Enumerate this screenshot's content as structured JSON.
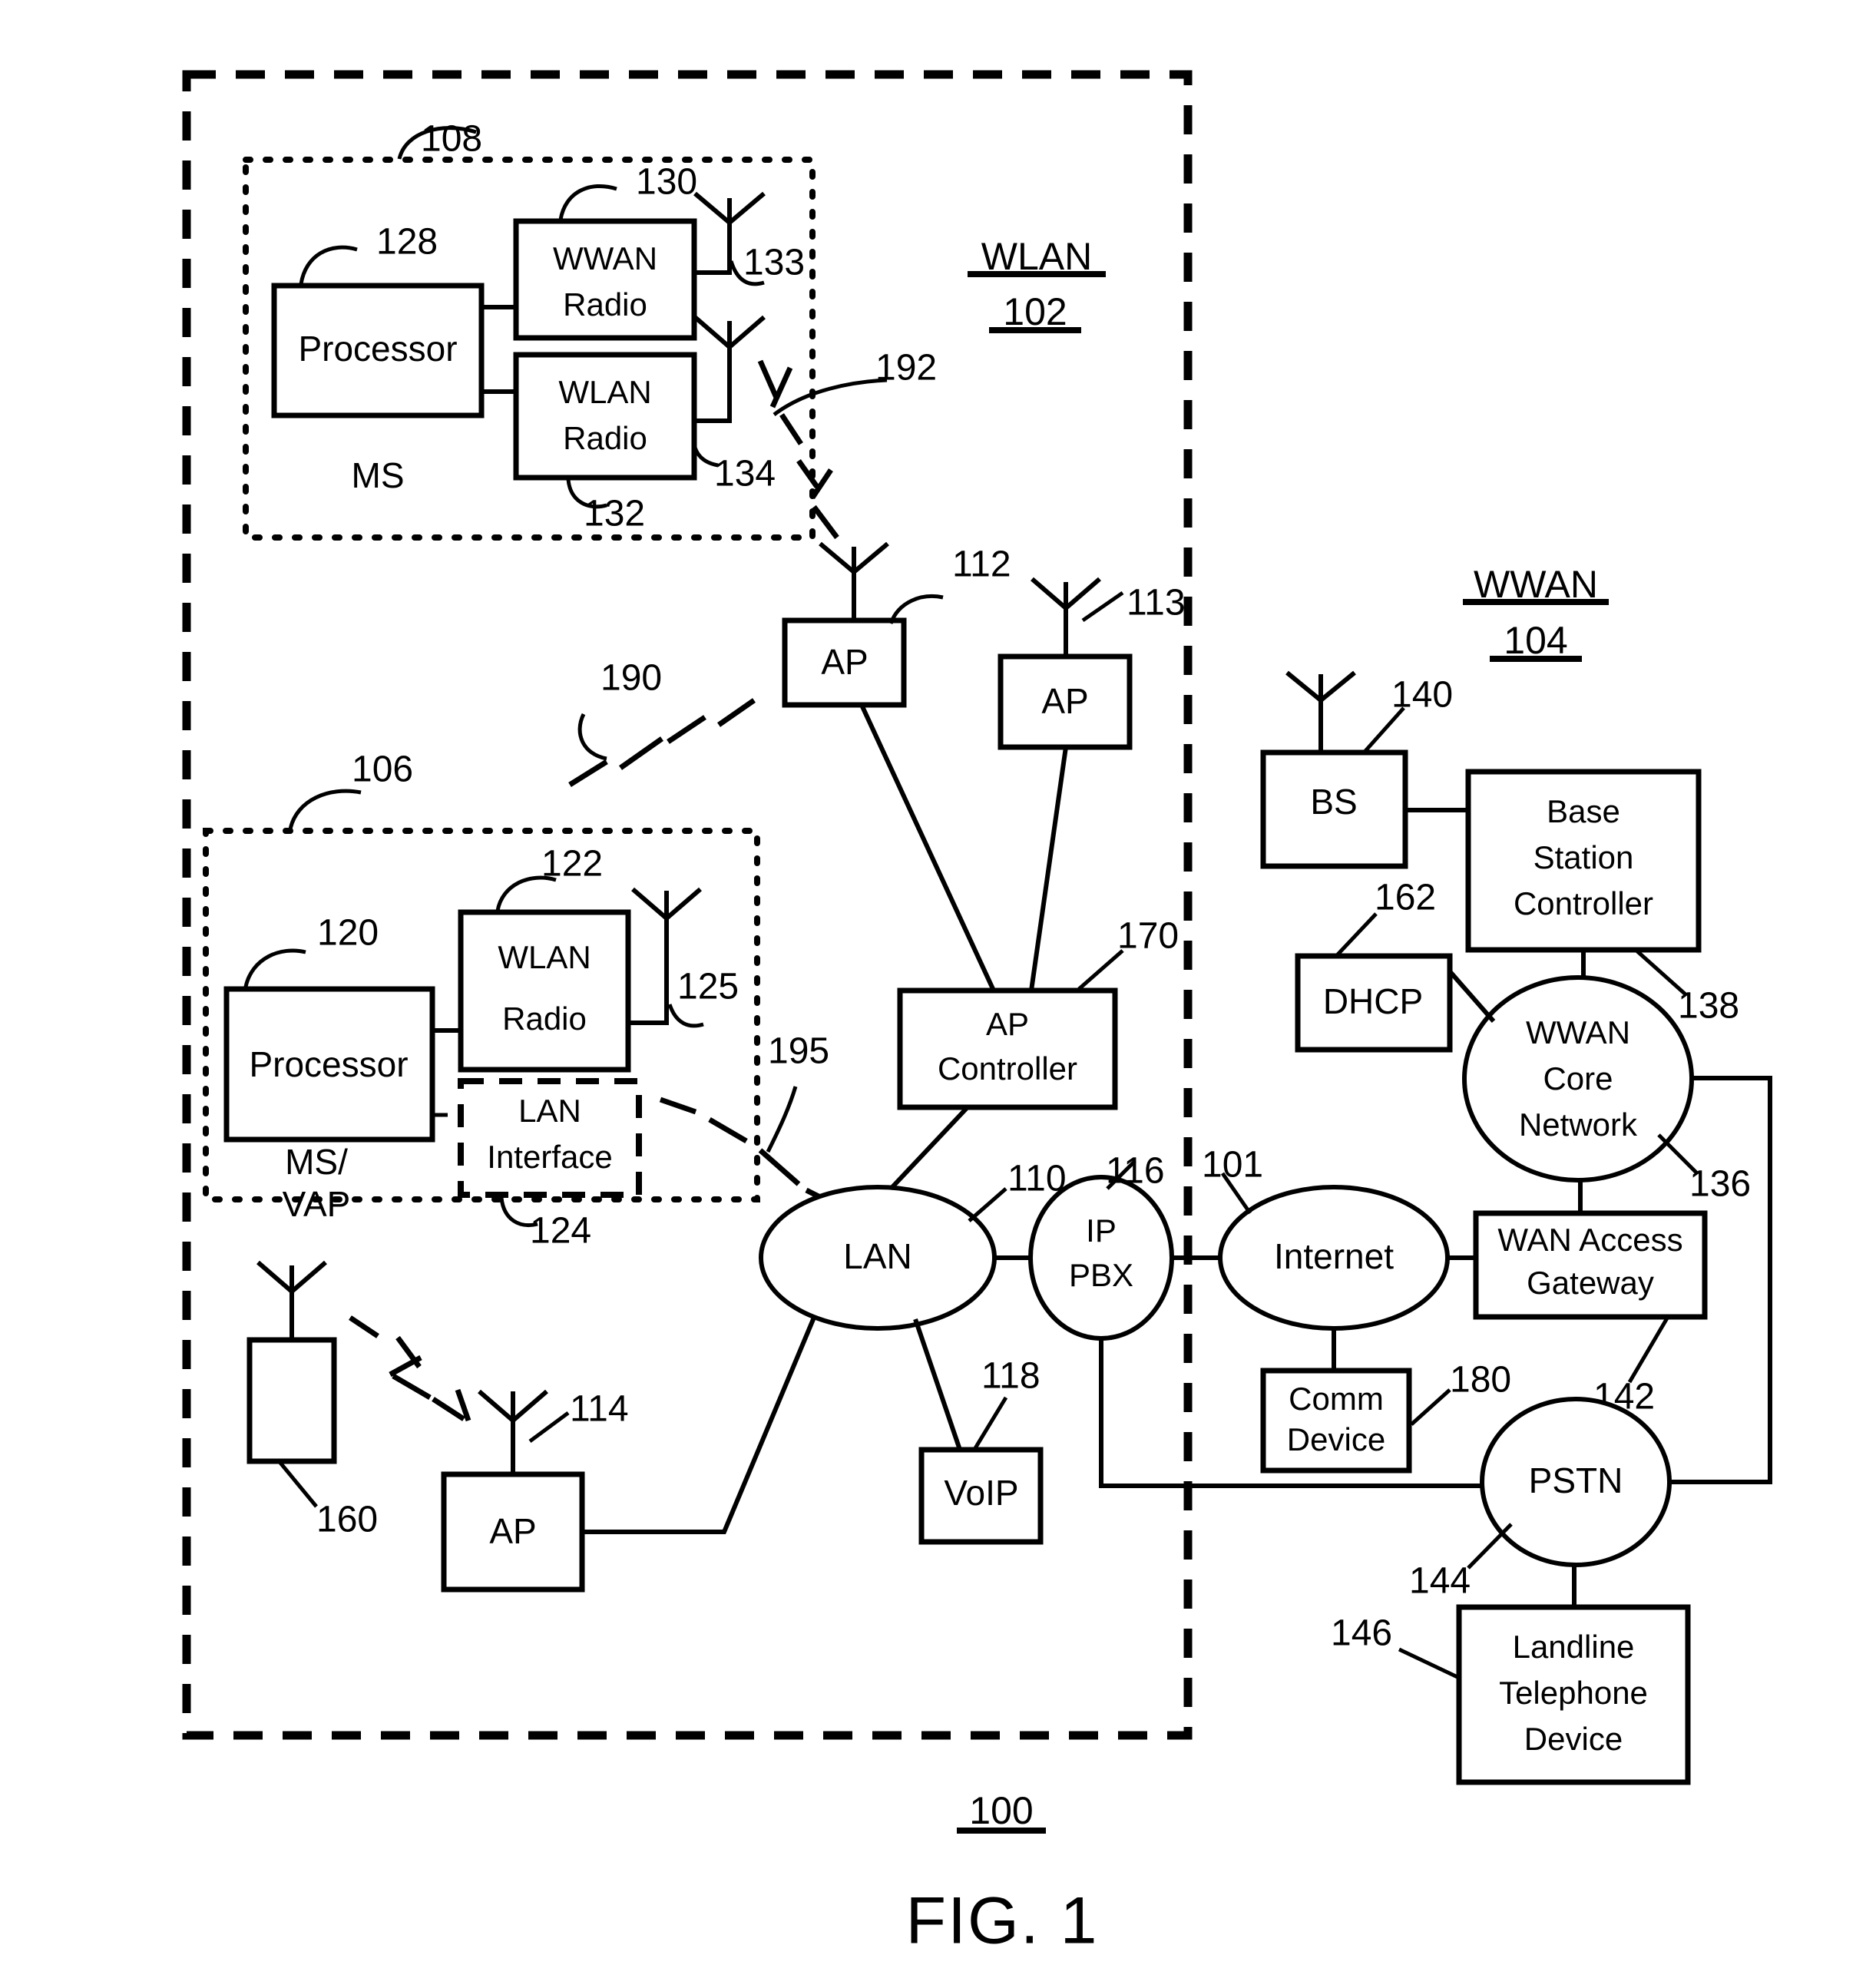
{
  "figure": {
    "title": "FIG. 1",
    "system_ref": "100"
  },
  "groups": [
    {
      "name": "WLAN",
      "ref": "102"
    },
    {
      "name": "WWAN",
      "ref": "104"
    }
  ],
  "nodes": {
    "ms_processor": {
      "label": "Processor",
      "ref": "128"
    },
    "ms_wwan_radio": {
      "label_line1": "WWAN",
      "label_line2": "Radio",
      "ref": "130"
    },
    "ms_wlan_radio": {
      "label_line1": "WLAN",
      "label_line2": "Radio",
      "ref": "132"
    },
    "ms_caption": {
      "label": "MS",
      "ref": "108"
    },
    "ms_antenna_wwan": {
      "ref": "133"
    },
    "ms_antenna_wlan": {
      "ref": "134"
    },
    "vap_processor": {
      "label": "Processor",
      "ref": "120"
    },
    "vap_wlan_radio": {
      "label_line1": "WLAN",
      "label_line2": "Radio",
      "ref": "122"
    },
    "vap_lan_interface": {
      "label_line1": "LAN",
      "label_line2": "Interface",
      "ref": "124"
    },
    "vap_caption": {
      "label_line1": "MS/",
      "label_line2": "VAP",
      "ref": "106"
    },
    "vap_antenna": {
      "ref": "125"
    },
    "ap_112": {
      "label": "AP",
      "ref": "112"
    },
    "ap_113": {
      "label": "AP",
      "ref": "113"
    },
    "ap_114": {
      "label": "AP",
      "ref": "114"
    },
    "ap_controller": {
      "label_line1": "AP",
      "label_line2": "Controller",
      "ref": "170"
    },
    "lan": {
      "label": "LAN",
      "ref": "110"
    },
    "ip_pbx": {
      "label_line1": "IP",
      "label_line2": "PBX",
      "ref": "116"
    },
    "voip": {
      "label": "VoIP",
      "ref": "118"
    },
    "internet": {
      "label": "Internet",
      "ref": "101"
    },
    "comm_device": {
      "label_line1": "Comm",
      "label_line2": "Device",
      "ref": "180"
    },
    "legacy_device": {
      "ref": "160"
    },
    "bs": {
      "label": "BS",
      "ref": "140"
    },
    "base_station_controller": {
      "label_line1": "Base",
      "label_line2": "Station",
      "label_line3": "Controller",
      "ref": "138"
    },
    "dhcp": {
      "label": "DHCP",
      "ref": "162"
    },
    "wwan_core_network": {
      "label_line1": "WWAN",
      "label_line2": "Core",
      "label_line3": "Network",
      "ref": "136"
    },
    "wan_access_gateway": {
      "label_line1": "WAN Access",
      "label_line2": "Gateway",
      "ref": "142"
    },
    "pstn": {
      "label": "PSTN",
      "ref": "144"
    },
    "landline_telephone": {
      "label_line1": "Landline",
      "label_line2": "Telephone",
      "label_line3": "Device",
      "ref": "146"
    }
  },
  "wireless_links": [
    {
      "ref": "192",
      "from": "ms_wlan_radio_antenna",
      "to": "ap_112"
    },
    {
      "ref": "190",
      "from": "vap_wlan_radio_antenna",
      "to": "ap_112"
    },
    {
      "ref": "195",
      "from": "vap_lan_interface",
      "to": "lan"
    }
  ],
  "colors": {
    "stroke": "#000000",
    "background": "#ffffff"
  }
}
